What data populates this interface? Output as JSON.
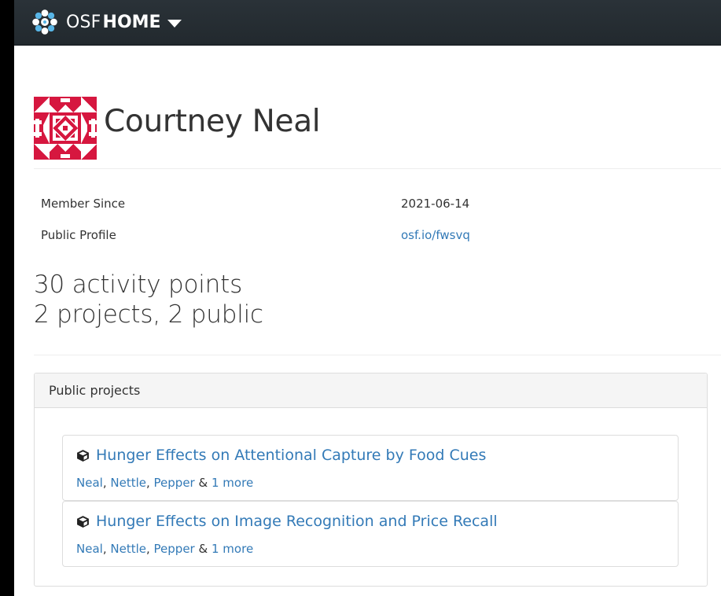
{
  "navbar": {
    "brand_prefix": "OSF",
    "brand_suffix": "HOME",
    "logo_icon": "osf-logo-icon",
    "caret_icon": "caret-down-icon",
    "background": "#263238"
  },
  "profile": {
    "name": "Courtney Neal",
    "avatar_icon": "identicon-avatar",
    "avatar_color": "#d6173f",
    "member_since_label": "Member Since",
    "member_since_value": "2021-06-14",
    "public_profile_label": "Public Profile",
    "public_profile_value": "osf.io/fwsvq"
  },
  "stats": {
    "activity": "30 activity points",
    "projects": "2 projects, 2 public"
  },
  "public_projects": {
    "heading": "Public projects",
    "items": [
      {
        "icon": "cube-icon",
        "title": "Hunger Effects on Attentional Capture by Food Cues",
        "authors": [
          "Neal",
          "Nettle",
          "Pepper"
        ],
        "sep1": ",",
        "sep2": ",",
        "amp": "&",
        "more": "1 more"
      },
      {
        "icon": "cube-icon",
        "title": "Hunger Effects on Image Recognition and Price Recall",
        "authors": [
          "Neal",
          "Nettle",
          "Pepper"
        ],
        "sep1": ",",
        "sep2": ",",
        "amp": "&",
        "more": "1 more"
      }
    ]
  },
  "colors": {
    "link": "#337ab7",
    "text": "#333333"
  }
}
